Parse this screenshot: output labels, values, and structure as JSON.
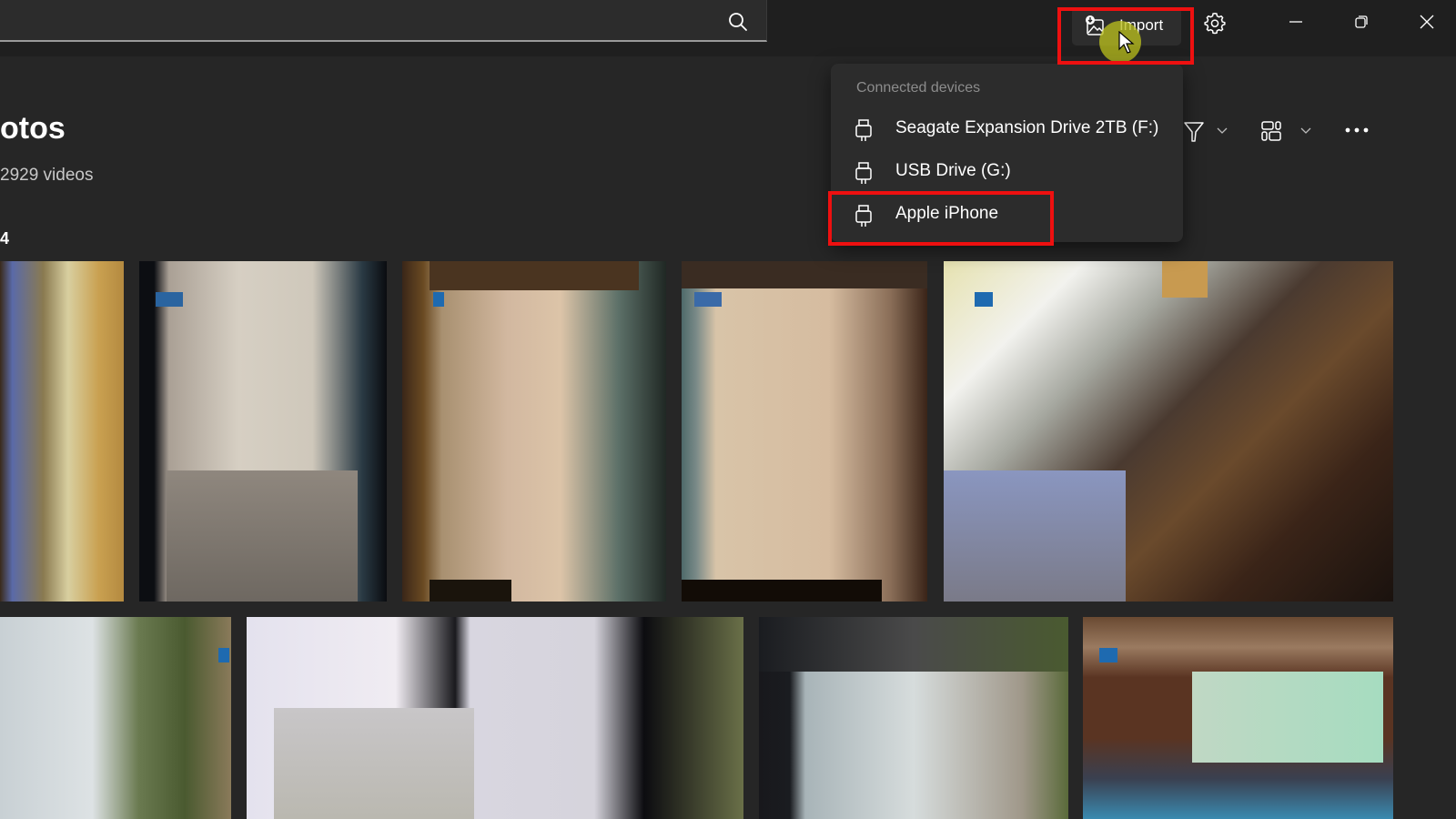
{
  "app": {
    "search": {
      "placeholder": "",
      "value": ""
    },
    "titlebar": {
      "import_label": "Import",
      "settings_icon": "gear-icon",
      "minimize_icon": "minimize-icon",
      "maximize_icon": "restore-icon",
      "close_icon": "close-icon"
    }
  },
  "main": {
    "title": "otos",
    "subtitle": "2929 videos",
    "section_label": "4",
    "toolbar": {
      "filter_icon": "filter-icon",
      "view_icon": "grid-view-icon",
      "more_icon": "more-icon"
    }
  },
  "import_menu": {
    "header": "Connected devices",
    "items": [
      {
        "label": "Seagate Expansion Drive 2TB (F:)",
        "icon": "usb-icon"
      },
      {
        "label": "USB Drive (G:)",
        "icon": "usb-icon"
      },
      {
        "label": "Apple iPhone",
        "icon": "usb-icon",
        "highlighted": true
      }
    ]
  },
  "annotations": {
    "highlight_color": "#ee1010",
    "cursor_halo_color": "#b9be1e"
  },
  "photos": [
    {
      "name": "photo-1"
    },
    {
      "name": "photo-2"
    },
    {
      "name": "photo-3"
    },
    {
      "name": "photo-4"
    },
    {
      "name": "photo-5"
    },
    {
      "name": "photo-6"
    },
    {
      "name": "photo-7"
    },
    {
      "name": "photo-8"
    },
    {
      "name": "photo-9"
    },
    {
      "name": "photo-10"
    }
  ]
}
